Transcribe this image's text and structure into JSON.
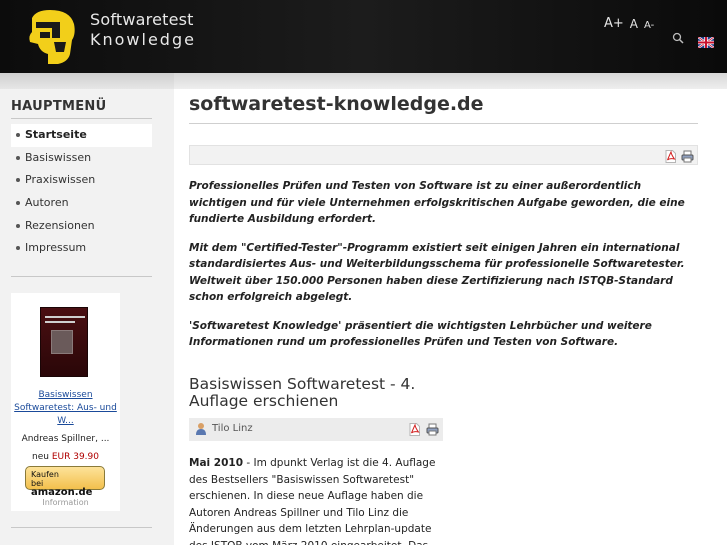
{
  "header": {
    "logo_line1": "Softwaretest",
    "logo_line2": "Knowledge",
    "font_increase": "A+",
    "font_default": "A",
    "font_decrease": "A-",
    "language_flag": "uk-flag-icon",
    "colors": {
      "header_bg": "#111111",
      "logo_yellow": "#f2cf1a"
    }
  },
  "sidebar": {
    "menu_title": "HAUPTMENÜ",
    "items": [
      {
        "label": "Startseite",
        "active": true
      },
      {
        "label": "Basiswissen",
        "active": false
      },
      {
        "label": "Praxiswissen",
        "active": false
      },
      {
        "label": "Autoren",
        "active": false
      },
      {
        "label": "Rezensionen",
        "active": false
      },
      {
        "label": "Impressum",
        "active": false
      }
    ],
    "book": {
      "title_link": "Basiswissen Softwaretest: Aus- und W...",
      "author": "Andreas Spillner, ...",
      "price_prefix": "neu",
      "price": "EUR 39.90",
      "amazon_button_line1": "Kaufen",
      "amazon_button_line2": "bei",
      "amazon_button_brand": "amazon.de",
      "info": "Information"
    }
  },
  "main": {
    "page_title": "softwaretest-knowledge.de",
    "intro_paragraphs": [
      "Professionelles Prüfen und Testen von Software ist zu einer außerordentlich wichtigen und für viele Unternehmen erfolgskritischen Aufgabe geworden, die eine fundierte Ausbildung erfordert.",
      "Mit dem \"Certified-Tester\"-Programm existiert seit einigen Jahren ein international standardisiertes Aus- und Weiterbildungsschema für professionelle Softwaretester. Weltweit über 150.000 Personen haben diese Zertifizierung nach ISTQB-Standard schon erfolgreich abgelegt.",
      "'Softwaretest Knowledge' präsentiert die wichtigsten Lehrbücher und weitere Informationen rund um professionelles Prüfen und Testen von Software."
    ],
    "article": {
      "title": "Basiswissen Softwaretest - 4. Auflage erschienen",
      "author": "Tilo Linz",
      "date_bold": "Mai 2010",
      "body": " - Im dpunkt Verlag ist die 4. Auflage des Bestsellers \"Basiswissen Softwaretest\" erschienen. In diese neue Auflage haben die Autoren Andreas Spillner und Tilo Linz die Änderungen aus dem letzten Lehrplan-update des ISTQB vom März 2010 eingearbeitet. Das Buch deckt damit die neueste"
    }
  }
}
